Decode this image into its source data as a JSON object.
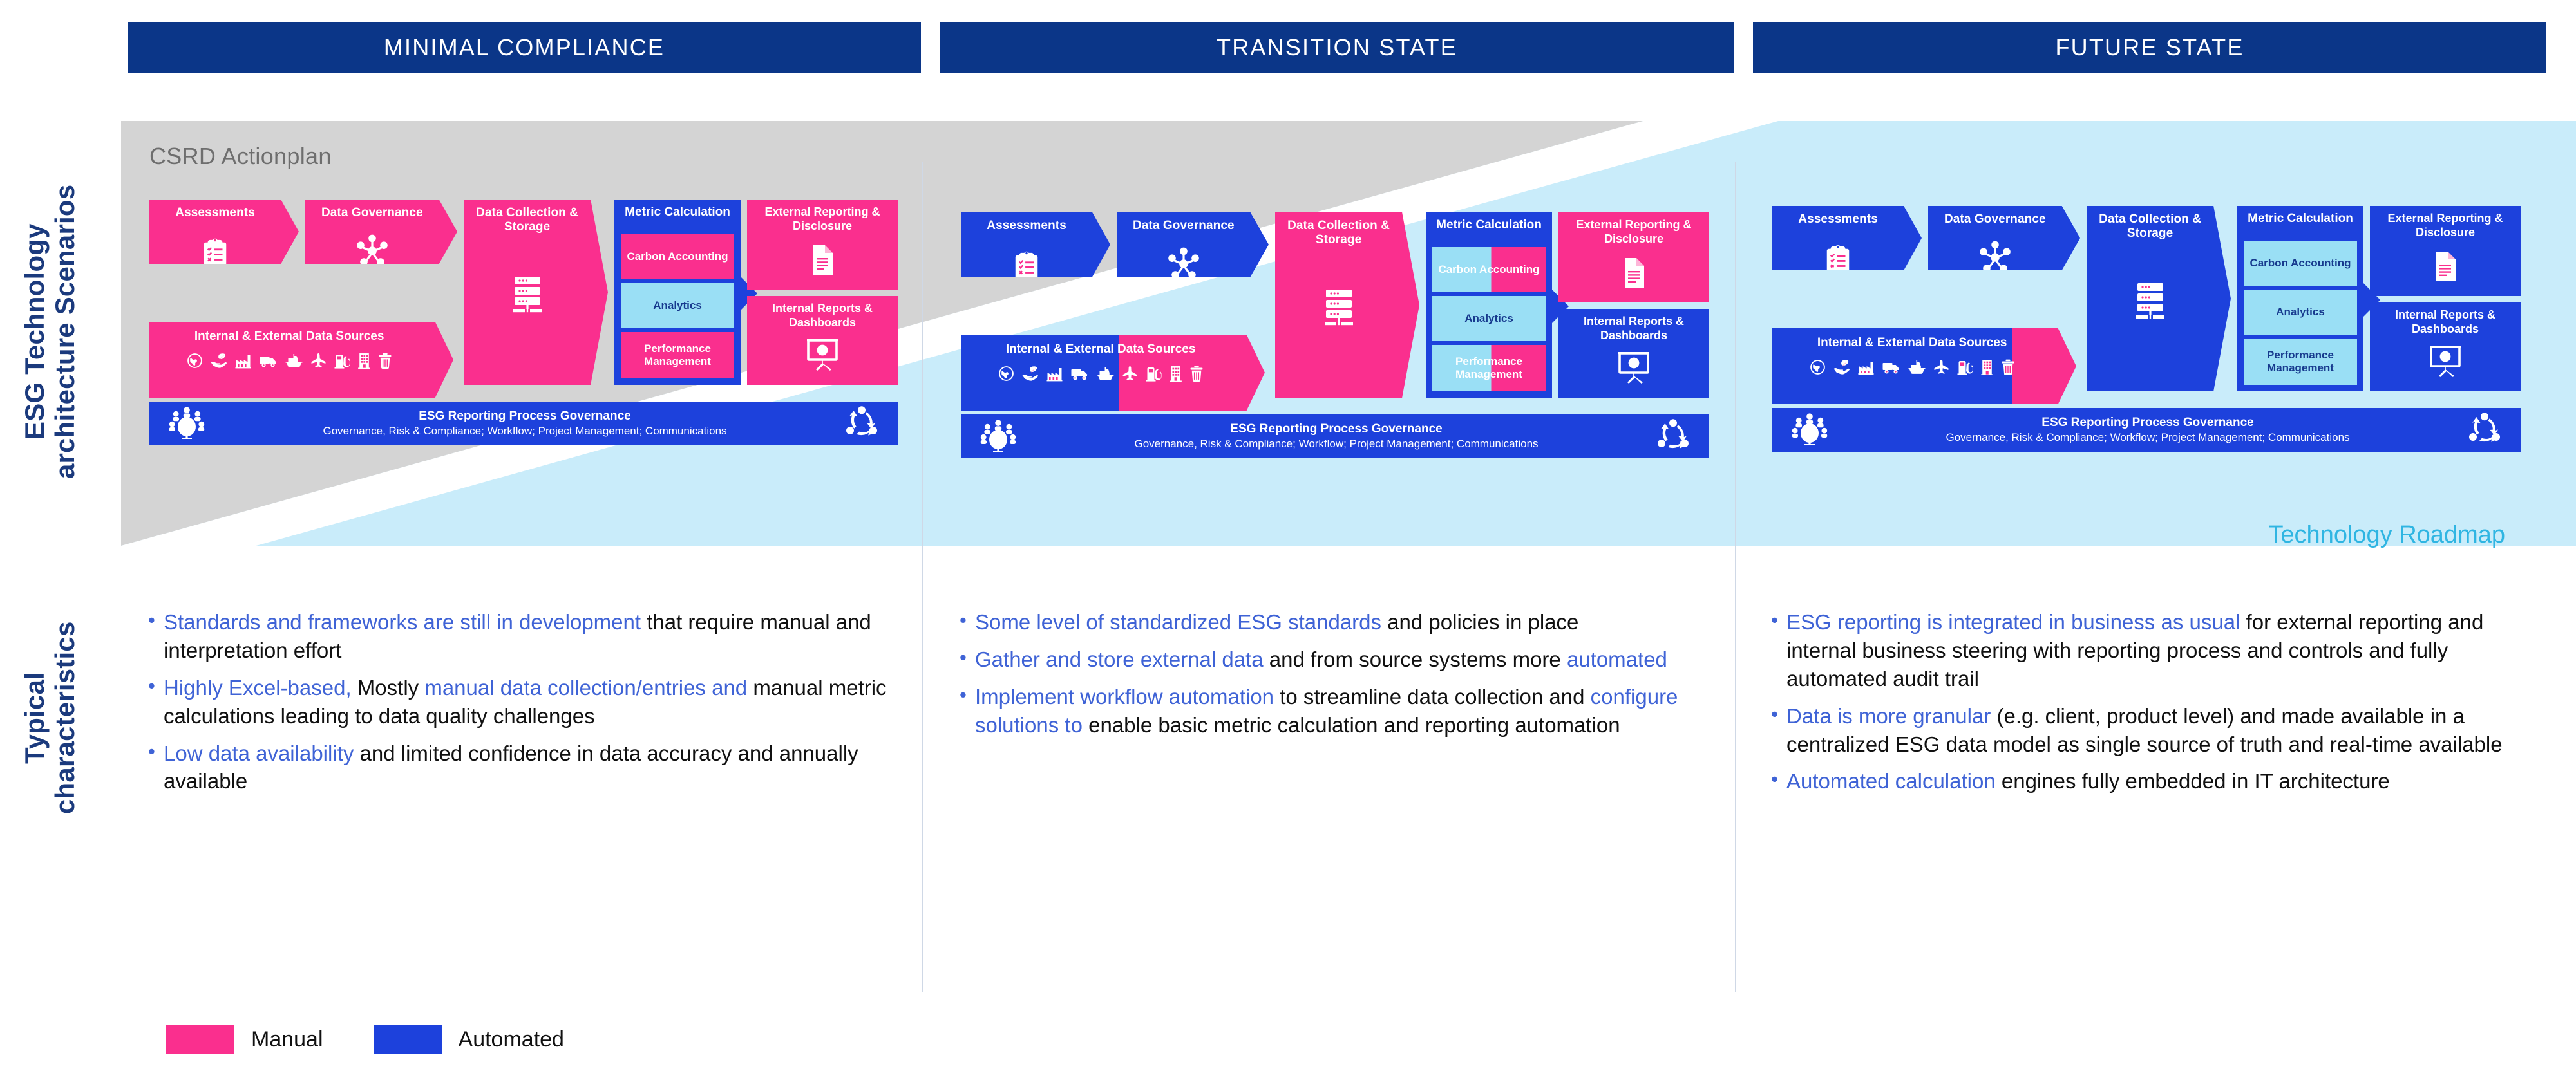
{
  "colors": {
    "header_blue": "#0b3688",
    "manual_pink": "#FA2F8E",
    "automated_blue": "#1d41dc",
    "light_blue": "#9ADFF5",
    "panel_grey": "#d4d4d4",
    "roadmap_blue": "#C9ECFA",
    "accent_text_blue": "#3f63d6",
    "label_blue": "#1b3a7d",
    "roadmap_text": "#2fb5e2"
  },
  "row_labels": {
    "architecture": "ESG Technology\narchitecture Scenarios",
    "architecture_line1": "ESG Technology",
    "architecture_line2": "architecture Scenarios",
    "characteristics_line1": "Typical",
    "characteristics_line2": "characteristics"
  },
  "panel": {
    "csrd_label": "CSRD Actionplan",
    "roadmap_label": "Technology Roadmap"
  },
  "legend": {
    "items": [
      {
        "label": "Manual",
        "color": "#FA2F8E"
      },
      {
        "label": "Automated",
        "color": "#1d41dc"
      }
    ]
  },
  "process_steps": {
    "assessments": "Assessments",
    "data_governance": "Data Governance",
    "data_collection": "Data Collection & Storage",
    "metric_calculation": "Metric Calculation",
    "external_reporting": "External Reporting & Disclosure",
    "internal_reports": "Internal Reports & Dashboards",
    "data_sources": "Internal & External Data Sources",
    "carbon_accounting": "Carbon Accounting",
    "analytics": "Analytics",
    "performance_management": "Performance Management"
  },
  "governance": {
    "title": "ESG Reporting Process Governance",
    "subtitle": "Governance, Risk & Compliance; Workflow; Project Management; Communications"
  },
  "data_source_icons": [
    "globe-icon",
    "hand-leaf-icon",
    "factory-icon",
    "truck-icon",
    "ship-icon",
    "airplane-icon",
    "fuel-pump-icon",
    "building-icon",
    "trash-icon"
  ],
  "columns": [
    {
      "id": "minimal-compliance",
      "header": "MINIMAL COMPLIANCE",
      "diagram": {
        "assessments_fill": "pink",
        "data_governance_fill": "pink",
        "data_collection_fill": "pink",
        "metric_shell_fill": "blue",
        "carbon_fill": "pink",
        "analytics_fill": "lightblue",
        "performance_fill": "pink",
        "external_reporting_fill": "pink",
        "internal_reports_fill": "pink",
        "data_sources_fill": "pink",
        "data_sources_split_pct": 100
      },
      "bullets": [
        [
          {
            "t": "Standards and frameworks are still in development",
            "hl": true
          },
          {
            "t": " that require manual and interpretation effort",
            "hl": false
          }
        ],
        [
          {
            "t": "Highly Excel-based,",
            "hl": true
          },
          {
            "t": " Mostly ",
            "hl": false
          },
          {
            "t": "manual data collection/entries and",
            "hl": true
          },
          {
            "t": " manual metric calculations leading to data quality challenges",
            "hl": false
          }
        ],
        [
          {
            "t": "Low data availability",
            "hl": true
          },
          {
            "t": " and limited confidence in data accuracy and annually available",
            "hl": false
          }
        ]
      ]
    },
    {
      "id": "transition-state",
      "header": "TRANSITION STATE",
      "diagram": {
        "assessments_fill": "blue",
        "data_governance_fill": "blue",
        "data_collection_fill": "pink",
        "metric_shell_fill": "blue",
        "carbon_fill": "split-lightblue-pink",
        "analytics_fill": "lightblue",
        "performance_fill": "split-lightblue-pink",
        "external_reporting_fill": "pink",
        "internal_reports_fill": "blue",
        "data_sources_fill": "split-blue-pink",
        "data_sources_split_pct": 52
      },
      "bullets": [
        [
          {
            "t": "Some level of standardized ESG standards",
            "hl": true
          },
          {
            "t": " and policies in place",
            "hl": false
          }
        ],
        [
          {
            "t": "Gather and store external data",
            "hl": true
          },
          {
            "t": " and from source systems more ",
            "hl": false
          },
          {
            "t": "automated",
            "hl": true
          }
        ],
        [
          {
            "t": "Implement workflow automation",
            "hl": true
          },
          {
            "t": " to streamline data collection and ",
            "hl": false
          },
          {
            "t": "configure solutions to",
            "hl": true
          },
          {
            "t": " enable basic metric calculation and reporting automation",
            "hl": false
          }
        ]
      ]
    },
    {
      "id": "future-state",
      "header": "FUTURE STATE",
      "diagram": {
        "assessments_fill": "blue",
        "data_governance_fill": "blue",
        "data_collection_fill": "blue",
        "metric_shell_fill": "blue",
        "carbon_fill": "lightblue",
        "analytics_fill": "lightblue",
        "performance_fill": "lightblue",
        "external_reporting_fill": "blue",
        "internal_reports_fill": "blue",
        "data_sources_fill": "split-blue-pink",
        "data_sources_split_pct": 79
      },
      "bullets": [
        [
          {
            "t": "ESG reporting is integrated in business as usual",
            "hl": true
          },
          {
            "t": " for external reporting and internal business steering with reporting process and controls and fully automated audit trail",
            "hl": false
          }
        ],
        [
          {
            "t": "Data is more granular",
            "hl": true
          },
          {
            "t": " (e.g. client, product level) and made available in a centralized ESG data model as single source of truth and real-time available",
            "hl": false
          }
        ],
        [
          {
            "t": "Automated calculation",
            "hl": true
          },
          {
            "t": " engines fully embedded in IT architecture",
            "hl": false
          }
        ]
      ]
    }
  ]
}
